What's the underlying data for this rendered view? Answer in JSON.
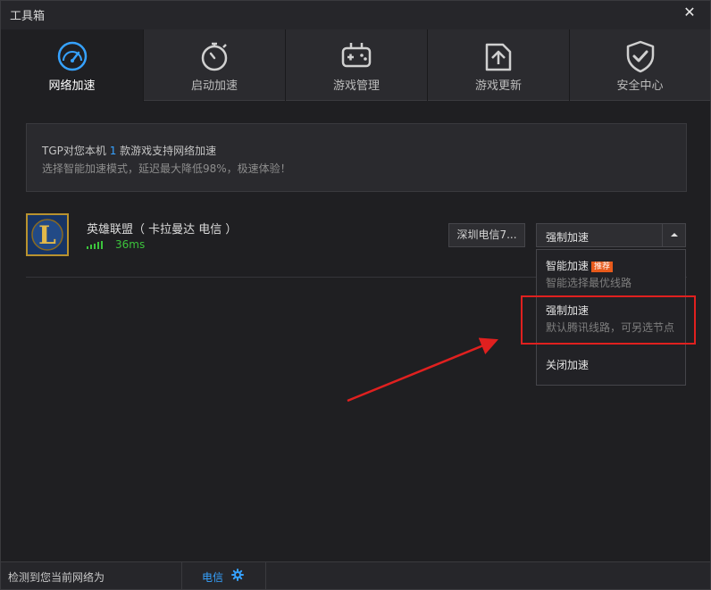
{
  "window": {
    "title": "工具箱",
    "close_glyph": "✕"
  },
  "tabs": [
    {
      "label": "网络加速",
      "icon": "speedometer-icon",
      "active": true
    },
    {
      "label": "启动加速",
      "icon": "stopwatch-icon",
      "active": false
    },
    {
      "label": "游戏管理",
      "icon": "gamepad-icon",
      "active": false
    },
    {
      "label": "游戏更新",
      "icon": "upload-folder-icon",
      "active": false
    },
    {
      "label": "安全中心",
      "icon": "shield-check-icon",
      "active": false
    }
  ],
  "info": {
    "line1_prefix": "TGP对您本机 ",
    "line1_count": "1",
    "line1_suffix": " 款游戏支持网络加速",
    "line2": "选择智能加速模式，延迟最大降低98%，极速体验！"
  },
  "game": {
    "title": "英雄联盟（ 卡拉曼达 电信 ）",
    "icon_letter": "L",
    "ping": "36ms",
    "server_button": "深圳电信7...",
    "mode_selected": "强制加速"
  },
  "dropdown": {
    "options": [
      {
        "title": "智能加速",
        "badge": "推荐",
        "subtitle": "智能选择最优线路"
      },
      {
        "title": "强制加速",
        "subtitle": "默认腾讯线路，可另选节点"
      },
      {
        "title": "关闭加速"
      }
    ]
  },
  "status": {
    "label": "检测到您当前网络为",
    "network": "电信"
  },
  "colors": {
    "accent_blue": "#36a2ff",
    "ping_green": "#3cc43c",
    "annotation_red": "#e0201f",
    "badge_orange": "#e85a1b"
  }
}
